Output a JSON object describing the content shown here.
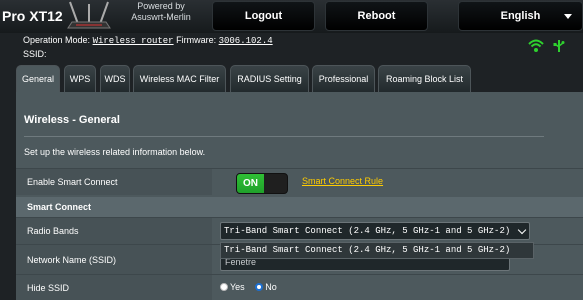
{
  "header": {
    "model": "Pro XT12",
    "powered_line1": "Powered by",
    "powered_line2": "Asuswrt-Merlin",
    "logout_label": "Logout",
    "reboot_label": "Reboot",
    "language_label": "English"
  },
  "info": {
    "op_mode_label": "Operation Mode:",
    "op_mode_value": "Wireless router",
    "firmware_label": "Firmware:",
    "firmware_value": "3006.102.4",
    "ssid_label": "SSID:"
  },
  "tabs": [
    {
      "label": "General",
      "active": true
    },
    {
      "label": "WPS"
    },
    {
      "label": "WDS"
    },
    {
      "label": "Wireless MAC Filter"
    },
    {
      "label": "RADIUS Setting"
    },
    {
      "label": "Professional"
    },
    {
      "label": "Roaming Block List"
    }
  ],
  "panel": {
    "title": "Wireless - General",
    "description": "Set up the wireless related information below."
  },
  "smart_connect": {
    "label": "Enable Smart Connect",
    "toggle_state": "ON",
    "rule_link": "Smart Connect Rule",
    "section_title": "Smart Connect"
  },
  "radio_bands": {
    "label": "Radio Bands",
    "selected": "Tri-Band Smart Connect (2.4 GHz, 5 GHz-1 and 5 GHz-2)",
    "dropdown_option": "Tri-Band Smart Connect (2.4 GHz, 5 GHz-1 and 5 GHz-2)"
  },
  "network_name": {
    "label": "Network Name (SSID)",
    "value": "Fenetre"
  },
  "hide_ssid": {
    "label": "Hide SSID",
    "yes_label": "Yes",
    "no_label": "No",
    "selected": "No"
  },
  "colors": {
    "accent_green": "#2fbf35",
    "link_yellow": "#ffcc00",
    "panel_bg": "#4d595d",
    "page_bg": "#1e2225"
  },
  "icons": [
    "router-icon",
    "wifi-icon",
    "usb-icon",
    "chevron-down-icon"
  ]
}
